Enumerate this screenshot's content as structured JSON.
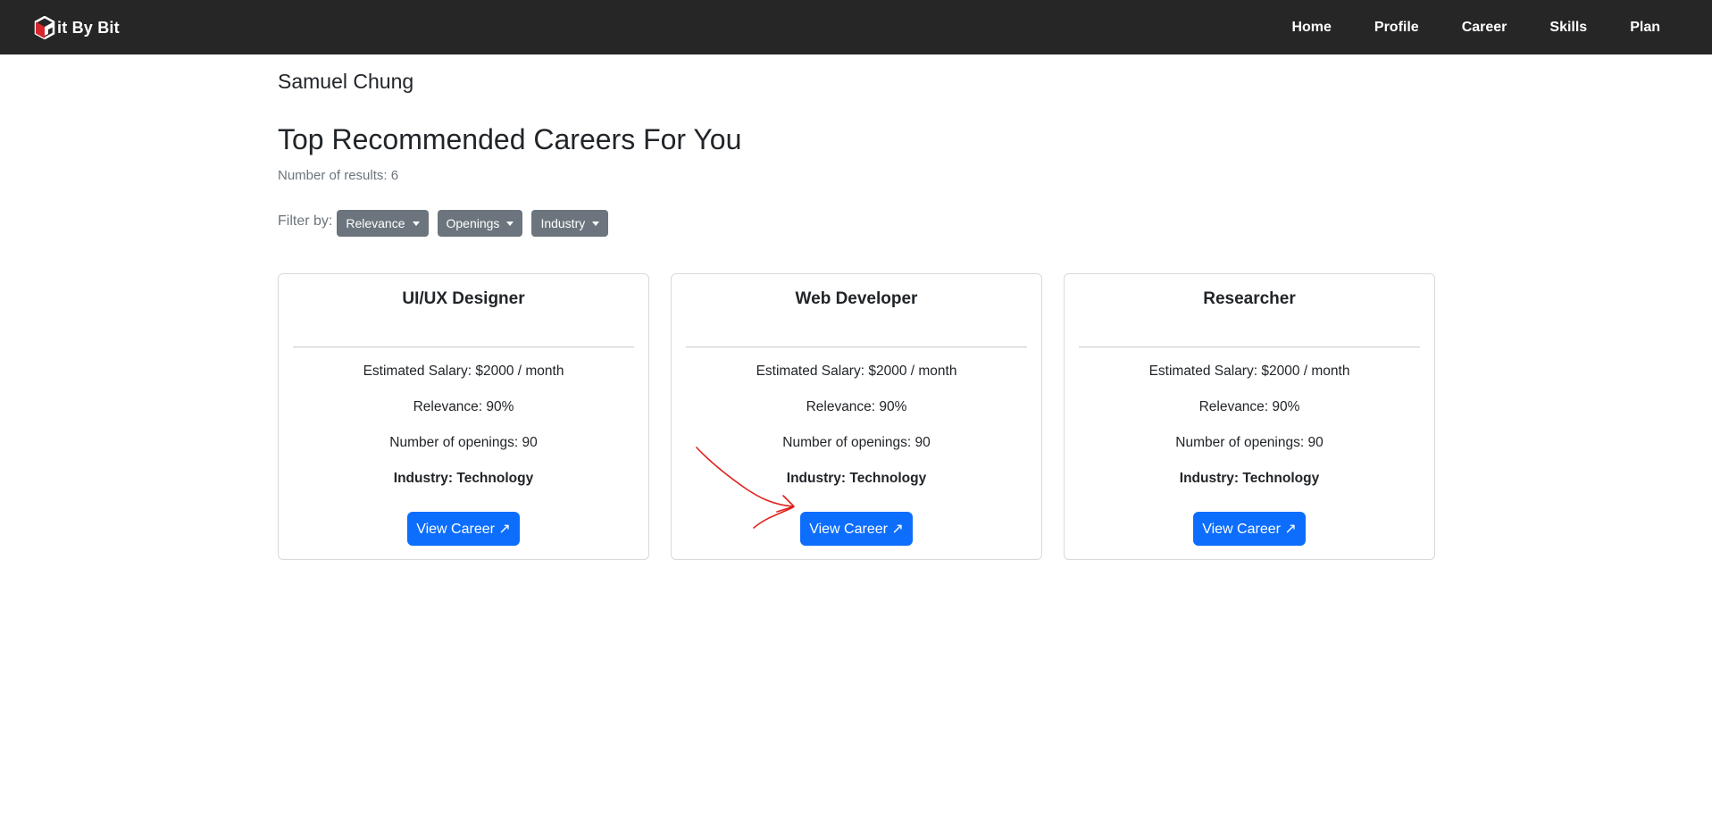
{
  "navbar": {
    "brand": "it By Bit",
    "logo_icon": "bit-by-bit-logo-icon",
    "links": [
      {
        "label": "Home"
      },
      {
        "label": "Profile"
      },
      {
        "label": "Career"
      },
      {
        "label": "Skills"
      },
      {
        "label": "Plan"
      }
    ]
  },
  "user": {
    "name": "Samuel Chung"
  },
  "page": {
    "title": "Top Recommended Careers For You",
    "results_label": "Number of results:",
    "results_count": "6"
  },
  "filters": {
    "label": "Filter by:",
    "buttons": [
      {
        "label": "Relevance"
      },
      {
        "label": "Openings"
      },
      {
        "label": "Industry"
      }
    ]
  },
  "cards": [
    {
      "title": "UI/UX Designer",
      "salary": "Estimated Salary: $2000 / month",
      "relevance": "Relevance: 90%",
      "openings": "Number of openings: 90",
      "industry": "Industry: Technology",
      "button": "View Career ↗"
    },
    {
      "title": "Web Developer",
      "salary": "Estimated Salary: $2000 / month",
      "relevance": "Relevance: 90%",
      "openings": "Number of openings: 90",
      "industry": "Industry: Technology",
      "button": "View Career ↗"
    },
    {
      "title": "Researcher",
      "salary": "Estimated Salary: $2000 / month",
      "relevance": "Relevance: 90%",
      "openings": "Number of openings: 90",
      "industry": "Industry: Technology",
      "button": "View Career ↗"
    }
  ],
  "colors": {
    "navbar_bg": "#262626",
    "primary": "#0d6efd",
    "secondary": "#6c757d",
    "annotation_arrow": "#e0201c"
  }
}
